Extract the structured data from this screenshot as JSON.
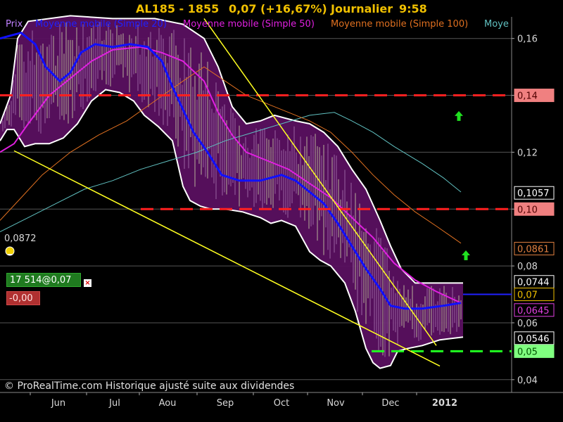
{
  "header": {
    "instrument": "AL185 - 1855",
    "price_change": "0,07 (+16,67%)",
    "period": "Journalier",
    "time": "9:58"
  },
  "legend": {
    "price_label": "Prix",
    "ma20_label": "Moyenne mobile (Simple 20)",
    "ma50_label": "Moyenne mobile (Simple 50)",
    "ma100_label": "Moyenne mobile (Simple 100)",
    "ma200_label": "Moye"
  },
  "footer": "© ProRealTime.com Historique ajusté suite aux dividendes",
  "order": {
    "position": "17 514@0,07",
    "pl": "-0,00"
  },
  "alert_level_label": "0,0872",
  "colors": {
    "background": "#000000",
    "price_area": "#5a1060",
    "ma20": "#1010ff",
    "ma50": "#e020e0",
    "ma100": "#e07020",
    "ma200": "#60c0c0",
    "trend_line": "#ffff20",
    "resistance": "#ff2020",
    "support": "#20ff20",
    "bollinger": "#ffffff"
  },
  "chart_data": {
    "type": "line",
    "x_labels": [
      "Jun",
      "Jul",
      "Aou",
      "Sep",
      "Oct",
      "Nov",
      "Dec",
      "2012"
    ],
    "y_ticks": [
      "0,16",
      "0,14",
      "0,12",
      "0,10",
      "0,08",
      "0,06",
      "0,04"
    ],
    "y_tick_values": [
      0.16,
      0.14,
      0.12,
      0.1,
      0.08,
      0.06,
      0.04
    ],
    "ylim": [
      0.0355,
      0.1671
    ],
    "price_tags": [
      {
        "label": "0,14",
        "value": 0.14,
        "bg": "#f08080",
        "fg": "#500000"
      },
      {
        "label": "0,1057",
        "value": 0.1057,
        "bg": "#000000",
        "fg": "#ffffff",
        "border": "#ffffff"
      },
      {
        "label": "0,10",
        "value": 0.1,
        "bg": "#f08080",
        "fg": "#500000"
      },
      {
        "label": "0,0861",
        "value": 0.0861,
        "bg": "#000000",
        "fg": "#e08040",
        "border": "#e08040"
      },
      {
        "label": "0,0744",
        "value": 0.0744,
        "bg": "#000000",
        "fg": "#ffffff",
        "border": "#ffffff"
      },
      {
        "label": "0,07",
        "value": 0.07,
        "bg": "#000000",
        "fg": "#f0c000",
        "border": "#f0c000"
      },
      {
        "label": "0,0645",
        "value": 0.0645,
        "bg": "#000000",
        "fg": "#e040e0",
        "border": "#e040e0"
      },
      {
        "label": "0,0546",
        "value": 0.0546,
        "bg": "#000000",
        "fg": "#ffffff",
        "border": "#ffffff"
      },
      {
        "label": "0,05",
        "value": 0.05,
        "bg": "#80ff80",
        "fg": "#005000"
      }
    ],
    "horizontal_levels": [
      {
        "name": "resistance-014",
        "value": 0.14,
        "color": "#ff2020",
        "style": "dashed"
      },
      {
        "name": "resistance-010",
        "value": 0.1,
        "color": "#ff2020",
        "style": "dashed"
      },
      {
        "name": "support-005",
        "value": 0.05,
        "color": "#20ff20",
        "style": "dashed"
      },
      {
        "name": "position-007",
        "value": 0.07,
        "color": "#2020ff",
        "style": "solid"
      }
    ],
    "series": [
      {
        "key": "ma20",
        "values": [
          [
            0,
            0.16
          ],
          [
            30,
            0.162
          ],
          [
            50,
            0.158
          ],
          [
            65,
            0.15
          ],
          [
            85,
            0.145
          ],
          [
            100,
            0.148
          ],
          [
            115,
            0.155
          ],
          [
            135,
            0.158
          ],
          [
            160,
            0.157
          ],
          [
            185,
            0.158
          ],
          [
            210,
            0.157
          ],
          [
            230,
            0.152
          ],
          [
            245,
            0.143
          ],
          [
            260,
            0.135
          ],
          [
            275,
            0.127
          ],
          [
            295,
            0.12
          ],
          [
            315,
            0.112
          ],
          [
            340,
            0.11
          ],
          [
            370,
            0.11
          ],
          [
            400,
            0.112
          ],
          [
            420,
            0.11
          ],
          [
            440,
            0.106
          ],
          [
            460,
            0.102
          ],
          [
            480,
            0.095
          ],
          [
            500,
            0.087
          ],
          [
            520,
            0.079
          ],
          [
            540,
            0.072
          ],
          [
            555,
            0.066
          ],
          [
            575,
            0.065
          ],
          [
            600,
            0.065
          ],
          [
            630,
            0.066
          ],
          [
            655,
            0.067
          ]
        ]
      },
      {
        "key": "ma50",
        "values": [
          [
            0,
            0.12
          ],
          [
            20,
            0.123
          ],
          [
            40,
            0.13
          ],
          [
            70,
            0.14
          ],
          [
            100,
            0.146
          ],
          [
            130,
            0.152
          ],
          [
            160,
            0.156
          ],
          [
            200,
            0.157
          ],
          [
            230,
            0.155
          ],
          [
            260,
            0.152
          ],
          [
            290,
            0.145
          ],
          [
            310,
            0.134
          ],
          [
            330,
            0.126
          ],
          [
            350,
            0.12
          ],
          [
            380,
            0.117
          ],
          [
            410,
            0.114
          ],
          [
            440,
            0.109
          ],
          [
            470,
            0.104
          ],
          [
            500,
            0.097
          ],
          [
            530,
            0.09
          ],
          [
            560,
            0.081
          ],
          [
            590,
            0.075
          ],
          [
            620,
            0.071
          ],
          [
            655,
            0.067
          ]
        ]
      },
      {
        "key": "ma100",
        "values": [
          [
            0,
            0.096
          ],
          [
            30,
            0.104
          ],
          [
            60,
            0.112
          ],
          [
            100,
            0.12
          ],
          [
            140,
            0.126
          ],
          [
            180,
            0.131
          ],
          [
            220,
            0.138
          ],
          [
            260,
            0.145
          ],
          [
            290,
            0.15
          ],
          [
            320,
            0.145
          ],
          [
            350,
            0.14
          ],
          [
            380,
            0.137
          ],
          [
            410,
            0.134
          ],
          [
            440,
            0.131
          ],
          [
            470,
            0.127
          ],
          [
            500,
            0.12
          ],
          [
            530,
            0.112
          ],
          [
            560,
            0.105
          ],
          [
            590,
            0.099
          ],
          [
            620,
            0.094
          ],
          [
            655,
            0.088
          ]
        ]
      },
      {
        "key": "ma200",
        "values": [
          [
            0,
            0.092
          ],
          [
            40,
            0.097
          ],
          [
            80,
            0.102
          ],
          [
            120,
            0.107
          ],
          [
            160,
            0.11
          ],
          [
            200,
            0.114
          ],
          [
            240,
            0.117
          ],
          [
            280,
            0.12
          ],
          [
            320,
            0.124
          ],
          [
            360,
            0.127
          ],
          [
            400,
            0.13
          ],
          [
            440,
            0.133
          ],
          [
            475,
            0.134
          ],
          [
            500,
            0.131
          ],
          [
            530,
            0.127
          ],
          [
            560,
            0.122
          ],
          [
            600,
            0.116
          ],
          [
            630,
            0.111
          ],
          [
            655,
            0.106
          ]
        ]
      },
      {
        "key": "bb_upper",
        "values": [
          [
            0,
            0.13
          ],
          [
            15,
            0.14
          ],
          [
            25,
            0.16
          ],
          [
            40,
            0.166
          ],
          [
            100,
            0.168
          ],
          [
            160,
            0.167
          ],
          [
            220,
            0.167
          ],
          [
            260,
            0.165
          ],
          [
            290,
            0.16
          ],
          [
            310,
            0.15
          ],
          [
            330,
            0.136
          ],
          [
            350,
            0.13
          ],
          [
            370,
            0.131
          ],
          [
            390,
            0.133
          ],
          [
            420,
            0.131
          ],
          [
            440,
            0.13
          ],
          [
            460,
            0.127
          ],
          [
            480,
            0.122
          ],
          [
            500,
            0.114
          ],
          [
            520,
            0.107
          ],
          [
            540,
            0.096
          ],
          [
            555,
            0.087
          ],
          [
            570,
            0.079
          ],
          [
            590,
            0.074
          ],
          [
            620,
            0.074
          ],
          [
            658,
            0.074
          ]
        ]
      },
      {
        "key": "bb_lower",
        "values": [
          [
            0,
            0.124
          ],
          [
            10,
            0.128
          ],
          [
            20,
            0.128
          ],
          [
            35,
            0.122
          ],
          [
            50,
            0.123
          ],
          [
            70,
            0.123
          ],
          [
            90,
            0.125
          ],
          [
            110,
            0.13
          ],
          [
            130,
            0.138
          ],
          [
            150,
            0.142
          ],
          [
            170,
            0.141
          ],
          [
            190,
            0.138
          ],
          [
            205,
            0.133
          ],
          [
            225,
            0.129
          ],
          [
            245,
            0.124
          ],
          [
            260,
            0.108
          ],
          [
            270,
            0.103
          ],
          [
            285,
            0.101
          ],
          [
            300,
            0.1
          ],
          [
            320,
            0.1
          ],
          [
            345,
            0.099
          ],
          [
            370,
            0.097
          ],
          [
            385,
            0.095
          ],
          [
            400,
            0.096
          ],
          [
            420,
            0.094
          ],
          [
            440,
            0.085
          ],
          [
            455,
            0.082
          ],
          [
            470,
            0.08
          ],
          [
            490,
            0.074
          ],
          [
            505,
            0.064
          ],
          [
            520,
            0.051
          ],
          [
            530,
            0.046
          ],
          [
            540,
            0.044
          ],
          [
            555,
            0.045
          ],
          [
            565,
            0.05
          ],
          [
            580,
            0.051
          ],
          [
            600,
            0.052
          ],
          [
            625,
            0.054
          ],
          [
            658,
            0.055
          ]
        ]
      }
    ],
    "trend_lines": [
      {
        "name": "upper-trend",
        "from": [
          290,
          0.167
        ],
        "to": [
          620,
          0.052
        ]
      },
      {
        "name": "lower-trend",
        "from": [
          20,
          0.1205
        ],
        "to": [
          625,
          0.0448
        ]
      }
    ],
    "arrows": [
      {
        "name": "arrow-up-1",
        "x": 652,
        "value": 0.1325
      },
      {
        "name": "arrow-up-2",
        "x": 662,
        "value": 0.0835
      }
    ]
  }
}
